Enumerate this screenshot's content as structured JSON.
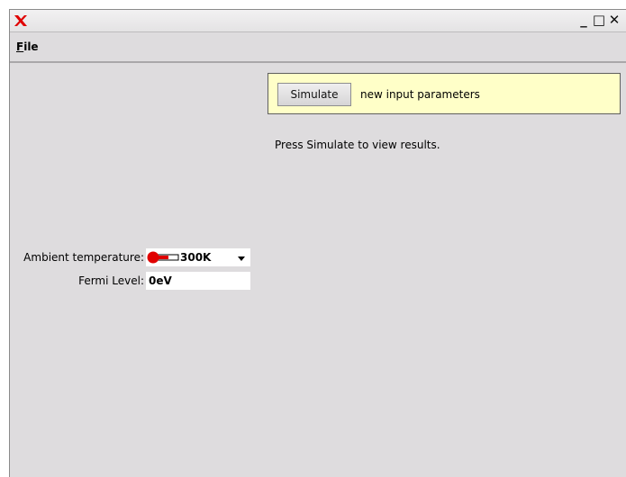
{
  "window": {
    "controls": {
      "minimize": "_",
      "maximize": "□",
      "close": "✕"
    }
  },
  "menu": {
    "file_label": "ile",
    "file_mnemonic": "F"
  },
  "simulate_panel": {
    "button_label": "Simulate",
    "message": "new input parameters",
    "background": "#ffffc8"
  },
  "status": {
    "text": "Press Simulate to view results."
  },
  "inputs": {
    "temperature": {
      "label": "Ambient temperature:",
      "value": "300K",
      "icon": "thermometer-icon"
    },
    "fermi": {
      "label": "Fermi Level:",
      "value": "0eV"
    }
  },
  "colors": {
    "accent_red": "#e00000",
    "window_bg": "#dedcde"
  }
}
